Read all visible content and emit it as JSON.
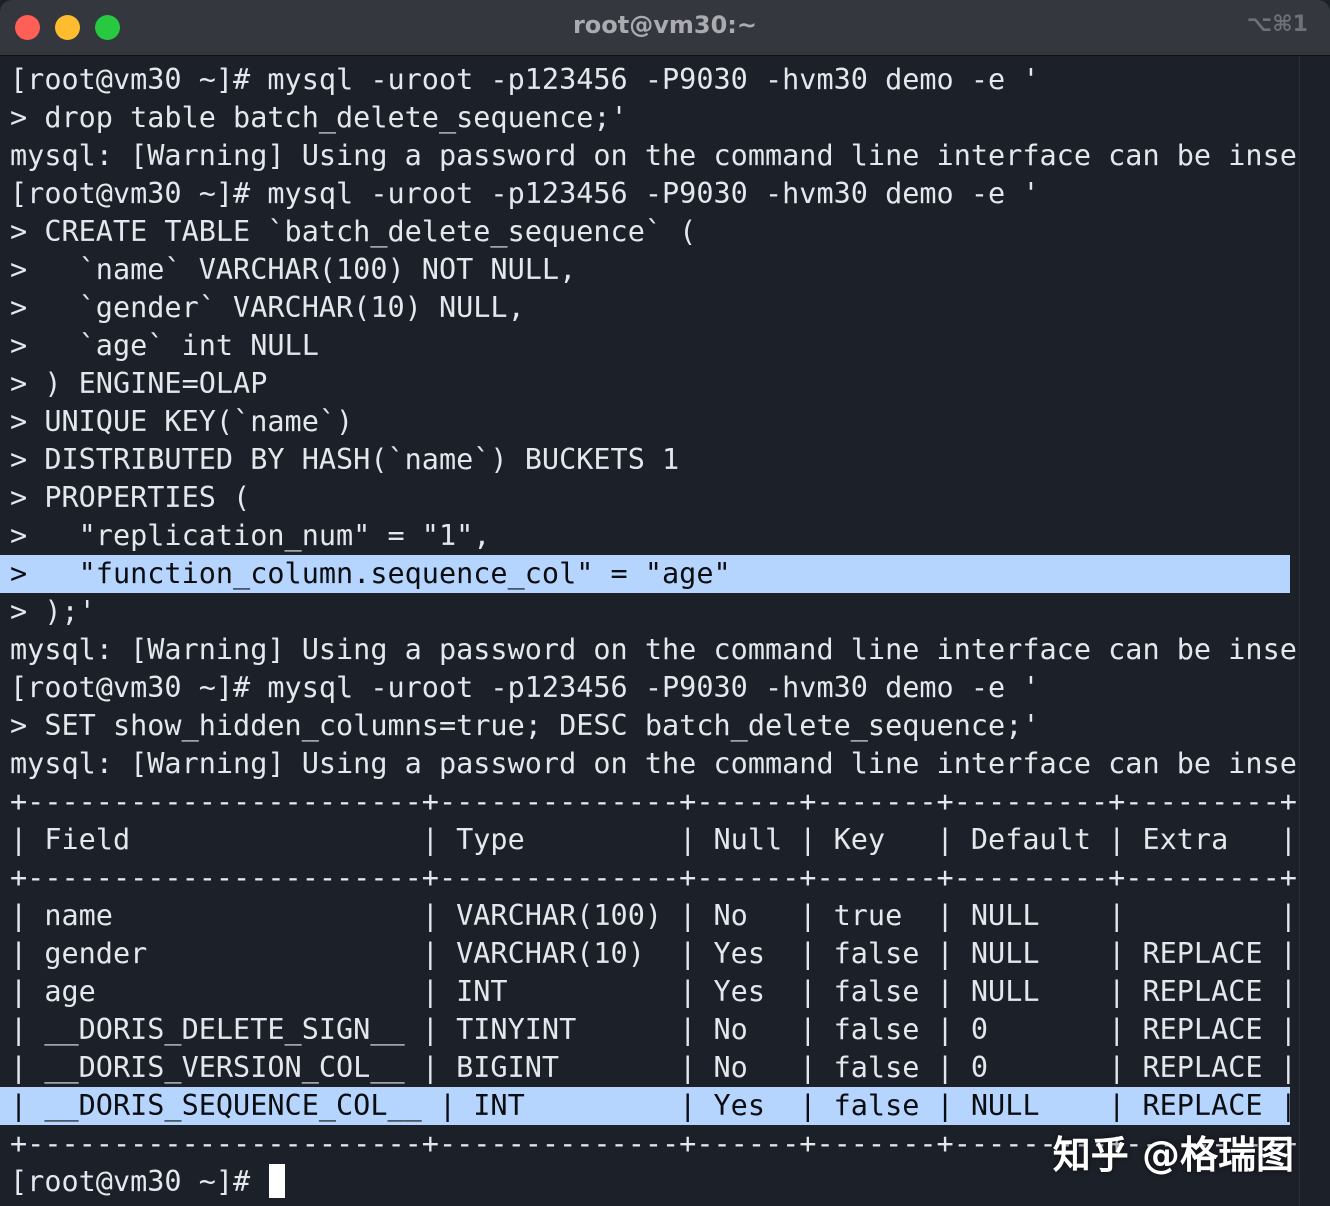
{
  "window": {
    "title": "root@vm30:~",
    "shortcut": "⌥⌘1"
  },
  "terminal": {
    "lines": [
      "[root@vm30 ~]# mysql -uroot -p123456 -P9030 -hvm30 demo -e '",
      "> drop table batch_delete_sequence;'",
      "mysql: [Warning] Using a password on the command line interface can be insecure.",
      "[root@vm30 ~]# mysql -uroot -p123456 -P9030 -hvm30 demo -e '",
      "> CREATE TABLE `batch_delete_sequence` (",
      ">   `name` VARCHAR(100) NOT NULL,",
      ">   `gender` VARCHAR(10) NULL,",
      ">   `age` int NULL",
      "> ) ENGINE=OLAP",
      "> UNIQUE KEY(`name`)",
      "> DISTRIBUTED BY HASH(`name`) BUCKETS 1",
      "> PROPERTIES (",
      ">   \"replication_num\" = \"1\",",
      ">   \"function_column.sequence_col\" = \"age\"",
      "> );'",
      "mysql: [Warning] Using a password on the command line interface can be insecure.",
      "[root@vm30 ~]# mysql -uroot -p123456 -P9030 -hvm30 demo -e '",
      "> SET show_hidden_columns=true; DESC batch_delete_sequence;'",
      "mysql: [Warning] Using a password on the command line interface can be insecure.",
      "+-----------------------+--------------+------+-------+---------+---------+",
      "| Field                 | Type         | Null | Key   | Default | Extra   |",
      "+-----------------------+--------------+------+-------+---------+---------+",
      "| name                  | VARCHAR(100) | No   | true  | NULL    |         |",
      "| gender                | VARCHAR(10)  | Yes  | false | NULL    | REPLACE |",
      "| age                   | INT          | Yes  | false | NULL    | REPLACE |",
      "| __DORIS_DELETE_SIGN__ | TINYINT      | No   | false | 0       | REPLACE |",
      "| __DORIS_VERSION_COL__ | BIGINT       | No   | false | 0       | REPLACE |",
      "| __DORIS_SEQUENCE_COL__ | INT         | Yes  | false | NULL    | REPLACE |",
      "+-----------------------+--------------+------+-------+---------+---------+",
      "[root@vm30 ~]# "
    ]
  },
  "watermark": "知乎 @格瑞图"
}
